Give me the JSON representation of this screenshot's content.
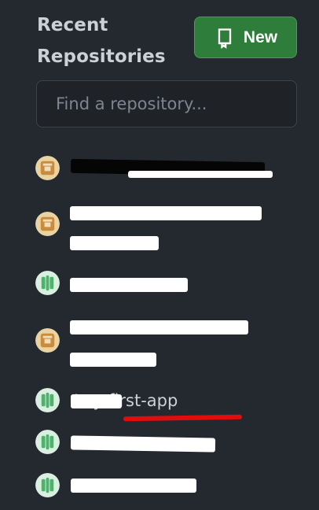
{
  "header": {
    "title_line1": "Recent",
    "title_line2": "Repositories",
    "new_button_label": "New"
  },
  "search": {
    "placeholder": "Find a repository...",
    "value": ""
  },
  "repositories": [
    {
      "owner": "",
      "separator": "",
      "name": "",
      "visibility": "private"
    },
    {
      "owner": "",
      "separator": "",
      "name": "",
      "visibility": "private"
    },
    {
      "owner": "",
      "separator": "",
      "name": "",
      "visibility": "public"
    },
    {
      "owner": "",
      "separator": "",
      "name": "",
      "visibility": "private"
    },
    {
      "owner": "",
      "separator": "/",
      "name": "my-first-app",
      "visibility": "public"
    },
    {
      "owner": "",
      "separator": "",
      "name": "",
      "visibility": "public"
    },
    {
      "owner": "",
      "separator": "",
      "name": "",
      "visibility": "public"
    }
  ],
  "colors": {
    "background": "#24292f",
    "new_button": "#2f7d3a",
    "annotation_underline": "#e10d0d"
  },
  "icons": {
    "new_button": "repo-icon",
    "avatar_private": "private-repo-avatar-icon",
    "avatar_public": "public-repo-avatar-icon"
  }
}
